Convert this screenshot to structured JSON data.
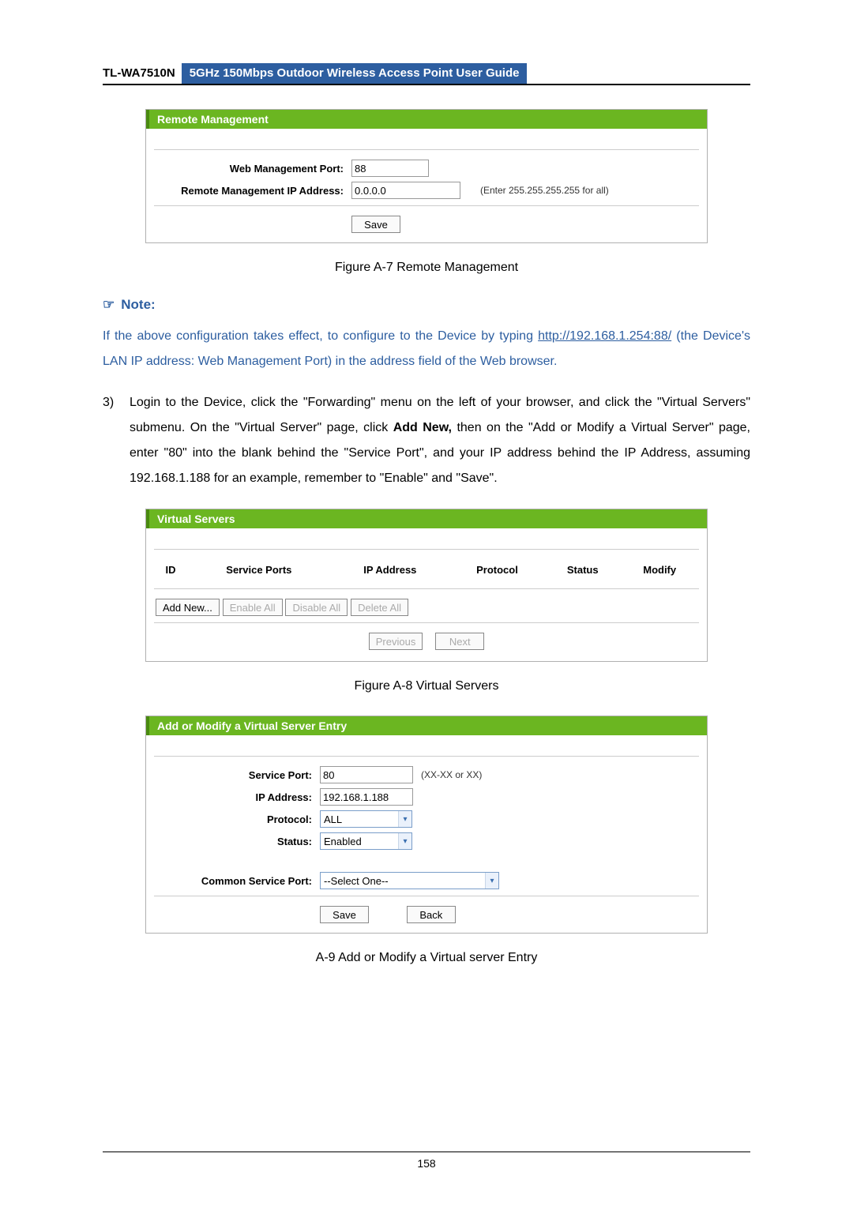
{
  "header": {
    "model": "TL-WA7510N",
    "title": "5GHz 150Mbps Outdoor Wireless Access Point User Guide"
  },
  "panel1": {
    "title": "Remote Management",
    "port_label": "Web Management Port:",
    "port_value": "88",
    "ip_label": "Remote Management IP Address:",
    "ip_value": "0.0.0.0",
    "ip_hint": "(Enter 255.255.255.255 for all)",
    "save": "Save"
  },
  "caption1": "Figure A-7 Remote Management",
  "note_label": "Note:",
  "note_text_a": "If the above configuration takes effect, to configure to the Device by typing ",
  "note_url": "http://192.168.1.254:88/",
  "note_text_b": " (the Device's LAN IP address: Web Management Port) in the address field of the Web browser.",
  "step3_num": "3)",
  "step3_a": "Login to the Device, click the \"Forwarding\" menu on the left of your browser, and click the \"Virtual Servers\" submenu. On the \"Virtual Server\" page, click ",
  "step3_bold": "Add New,",
  "step3_b": " then on the \"Add or Modify a Virtual Server\" page, enter \"80\" into the blank behind the \"Service Port\", and your IP address behind the IP Address, assuming 192.168.1.188 for an example, remember to \"Enable\" and \"Save\".",
  "panel2": {
    "title": "Virtual Servers",
    "cols": [
      "ID",
      "Service Ports",
      "IP Address",
      "Protocol",
      "Status",
      "Modify"
    ],
    "btns": {
      "add": "Add New...",
      "enable": "Enable All",
      "disable": "Disable All",
      "delete": "Delete All",
      "prev": "Previous",
      "next": "Next"
    }
  },
  "caption2": "Figure A-8 Virtual Servers",
  "panel3": {
    "title": "Add or Modify a Virtual Server Entry",
    "sp_label": "Service Port:",
    "sp_value": "80",
    "sp_hint": "(XX-XX or XX)",
    "ip_label": "IP Address:",
    "ip_value": "192.168.1.188",
    "proto_label": "Protocol:",
    "proto_value": "ALL",
    "status_label": "Status:",
    "status_value": "Enabled",
    "csp_label": "Common Service Port:",
    "csp_value": "--Select One--",
    "save": "Save",
    "back": "Back"
  },
  "caption3": "A-9 Add or Modify a Virtual server Entry",
  "page_number": "158"
}
